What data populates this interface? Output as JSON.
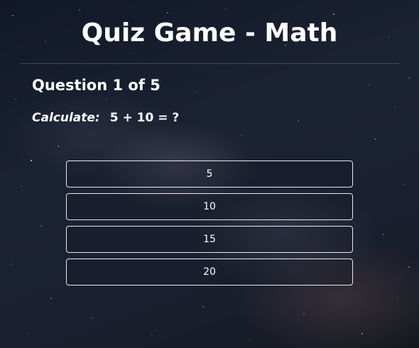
{
  "header": {
    "title": "Quiz Game - Math"
  },
  "question": {
    "counter": "Question 1 of 5",
    "prompt_label": "Calculate:",
    "expression": "5 + 10 = ?"
  },
  "answers": [
    {
      "label": "5"
    },
    {
      "label": "10"
    },
    {
      "label": "15"
    },
    {
      "label": "20"
    }
  ],
  "colors": {
    "text": "#ffffff",
    "background": "#1b2232",
    "button_border": "#ffffff"
  }
}
